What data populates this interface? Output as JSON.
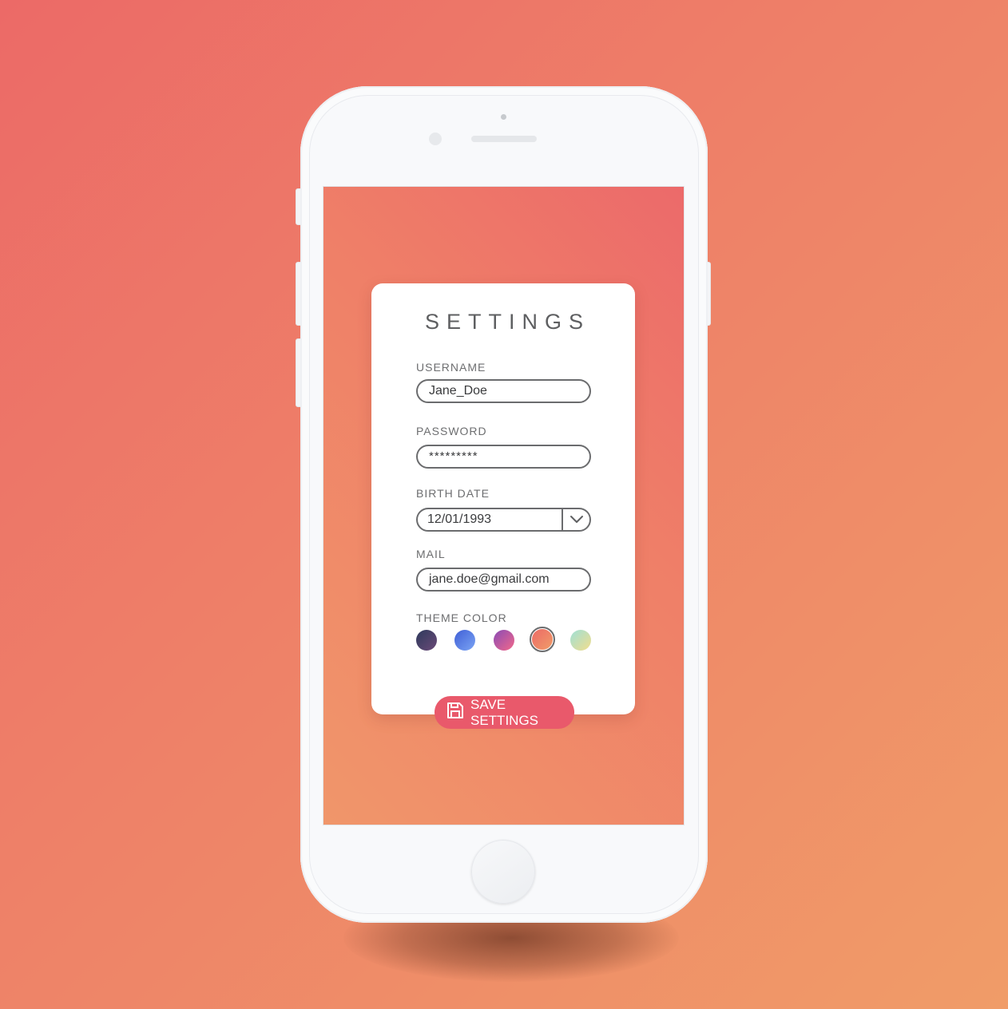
{
  "settings": {
    "title": "SETTINGS",
    "username": {
      "label": "USERNAME",
      "value": "Jane_Doe"
    },
    "password": {
      "label": "PASSWORD",
      "value": "*********"
    },
    "birth_date": {
      "label": "BIRTH DATE",
      "value": "12/01/1993"
    },
    "mail": {
      "label": "MAIL",
      "value": "jane.doe@gmail.com"
    },
    "theme_color": {
      "label": "THEME COLOR",
      "selected_index": 3,
      "swatches": [
        {
          "name": "midnight",
          "from": "#2e3a5c",
          "to": "#6b4a78"
        },
        {
          "name": "ocean",
          "from": "#3f5fd6",
          "to": "#7ba4f4"
        },
        {
          "name": "violet",
          "from": "#8a4bb5",
          "to": "#f2688a"
        },
        {
          "name": "sunset",
          "from": "#ec6a67",
          "to": "#f09c68"
        },
        {
          "name": "mint",
          "from": "#9fe0d6",
          "to": "#f2dd8c"
        }
      ]
    },
    "save_label": "SAVE SETTINGS"
  },
  "colors": {
    "accent": "#e9596b",
    "background_from": "#ec6a67",
    "background_to": "#f09c68"
  }
}
